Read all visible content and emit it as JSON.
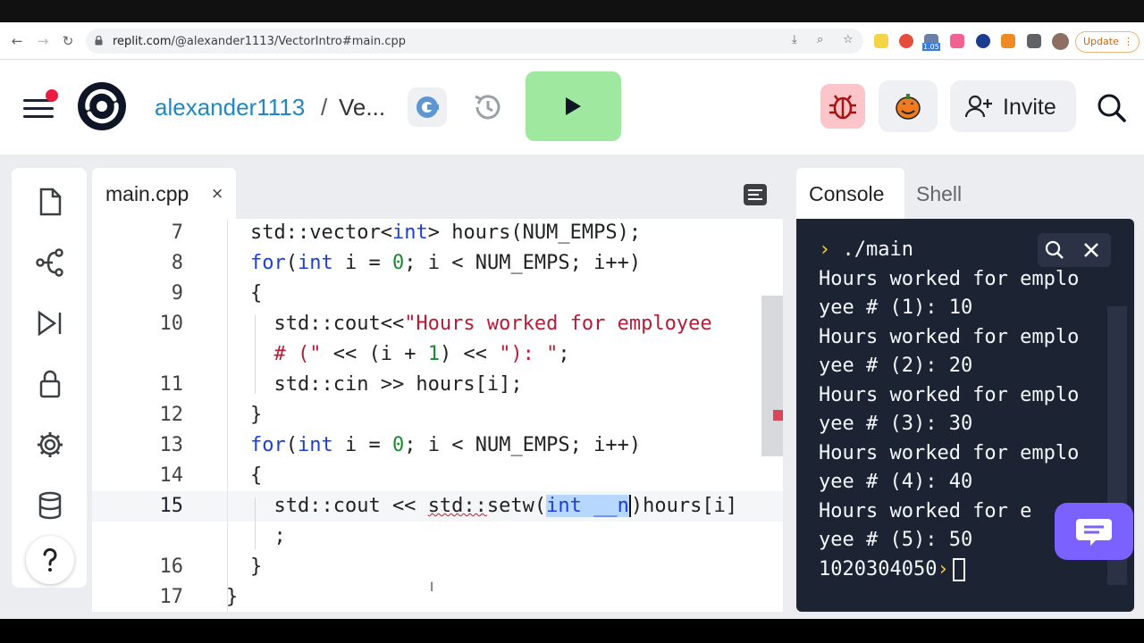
{
  "browser": {
    "url_host": "replit.com",
    "url_path": "/@alexander1113/VectorIntro#main.cpp",
    "update_label": "Update",
    "ext_badge": "1.05"
  },
  "header": {
    "owner": "alexander1113",
    "slash": "/",
    "repl_name": "Ve...",
    "invite_label": "Invite"
  },
  "editor": {
    "tab_label": "main.cpp",
    "tab_close": "×",
    "line_numbers": [
      "7",
      "8",
      "9",
      "10",
      "11",
      "12",
      "13",
      "14",
      "15",
      "16",
      "17"
    ]
  },
  "console": {
    "tab_console": "Console",
    "tab_shell": "Shell",
    "command": "./main",
    "output": [
      "Hours worked for emplo",
      "yee # (1): 10",
      "Hours worked for emplo",
      "yee # (2): 20",
      "Hours worked for emplo",
      "yee # (3): 30",
      "Hours worked for emplo",
      "yee # (4): 40",
      "Hours worked for e",
      "yee # (5): 50"
    ],
    "final_line": "1020304050"
  },
  "colors": {
    "accent_blue": "#1e88c7",
    "run_green": "#9fe8a0",
    "console_bg": "#1c2333",
    "chat_purple": "#7b61ff"
  }
}
